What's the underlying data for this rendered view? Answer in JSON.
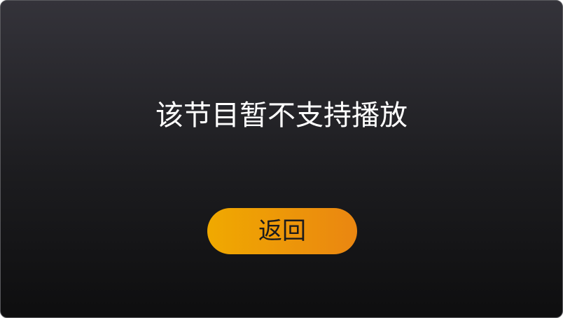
{
  "dialog": {
    "message": "该节目暂不支持播放",
    "back_button_label": "返回"
  },
  "colors": {
    "background_top": "#34333a",
    "background_bottom": "#0e0e0f",
    "button_start": "#f0a900",
    "button_end": "#ea8611",
    "message_text": "#ffffff",
    "button_text": "#1b1b1d"
  }
}
